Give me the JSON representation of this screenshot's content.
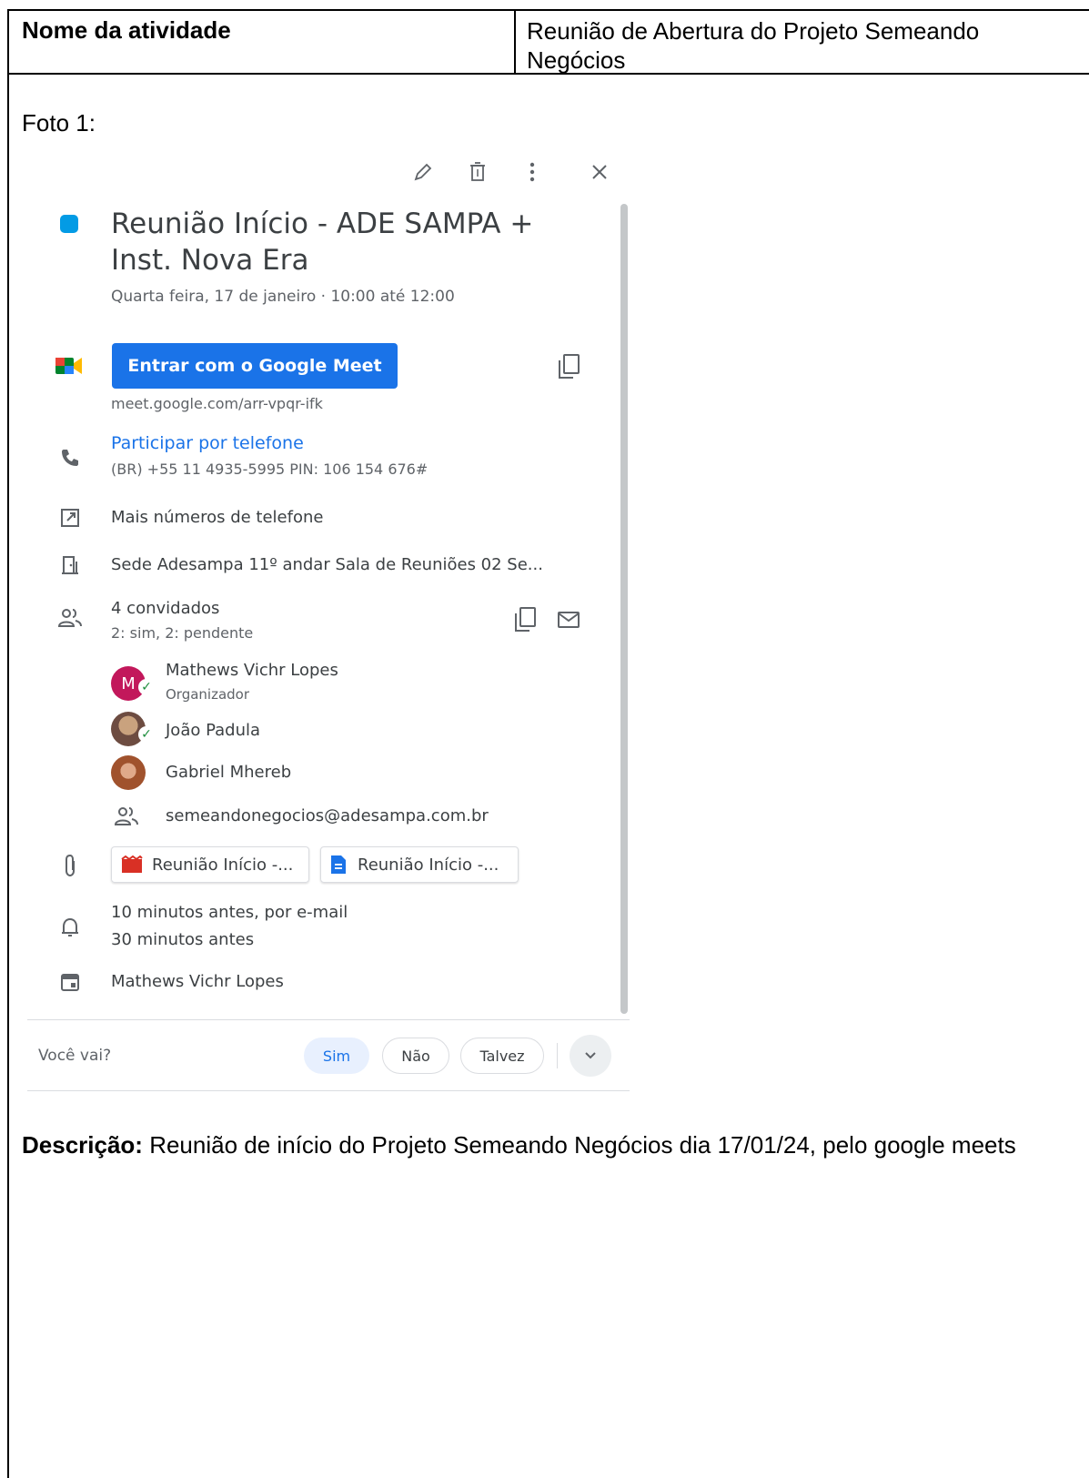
{
  "header": {
    "label": "Nome da atividade",
    "value": "Reunião de Abertura do Projeto Semeando Negócios"
  },
  "photo_label": "Foto 1:",
  "event": {
    "color": "#039be5",
    "title": "Reunião Início - ADE SAMPA + Inst. Nova Era",
    "datetime": "Quarta feira, 17 de janeiro  ·  10:00 até 12:00",
    "meet_button": "Entrar com o Google Meet",
    "meet_link": "meet.google.com/arr-vpqr-ifk",
    "phone_link": "Participar por telefone",
    "phone_number": "(BR) +55 11 4935-5995 PIN: 106 154 676#",
    "more_numbers": "Mais números de telefone",
    "location": "Sede Adesampa 11º andar Sala de Reuniões 02   Se...",
    "guests_count": "4 convidados",
    "guests_status": "2: sim, 2: pendente",
    "guests": [
      {
        "name": "Mathews Vichr Lopes",
        "role": "Organizador",
        "initial": "M",
        "color": "#c2185b"
      },
      {
        "name": "João Padula",
        "color": "#8d6e63"
      },
      {
        "name": "Gabriel Mhereb",
        "color": "#b5654a"
      },
      {
        "name": "semeandonegocios@adesampa.com.br"
      }
    ],
    "attachments": [
      "Reunião Início -...",
      "Reunião Início -..."
    ],
    "reminders": [
      "10 minutos antes, por e-mail",
      "30 minutos antes"
    ],
    "calendar_owner": "Mathews Vichr Lopes",
    "rsvp": {
      "question": "Você vai?",
      "yes": "Sim",
      "no": "Não",
      "maybe": "Talvez"
    }
  },
  "description": {
    "label": "Descrição:",
    "text": " Reunião de início do Projeto Semeando Negócios dia 17/01/24, pelo google meets"
  }
}
